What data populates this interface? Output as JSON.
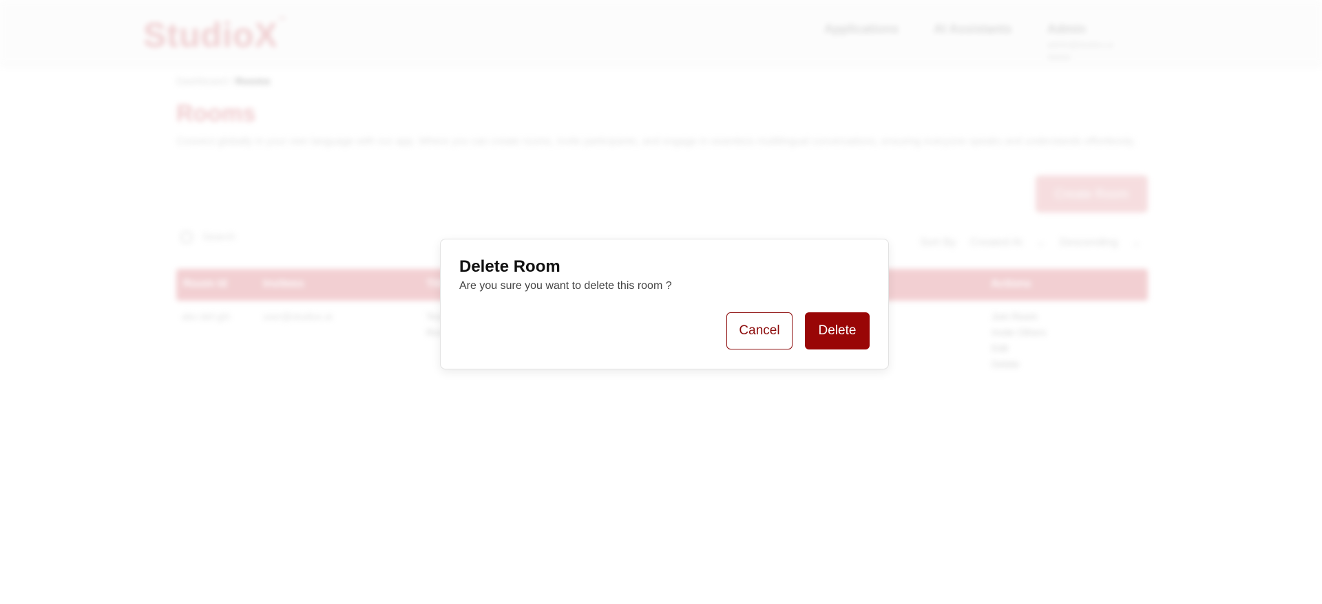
{
  "header": {
    "logo": "StudioX",
    "logo_trademark": "™",
    "nav": {
      "applications": "Applications",
      "ai_assistants": "AI Assistants",
      "admin": "Admin",
      "admin_email": "admin@studiox.ai",
      "admin_role": "Admin"
    }
  },
  "breadcrumb": {
    "parent": "Dashboard",
    "separator": "/",
    "current": "Rooms"
  },
  "page": {
    "title": "Rooms",
    "description": "Connect globally in your own language with our app. Where you can create rooms, invite participants, and engage in seamless multilingual conversations, ensuring everyone speaks and understands effortlessly.",
    "create_button": "Create Room"
  },
  "toolbar": {
    "search_placeholder": "Search",
    "sort_label": "Sort By",
    "sort_field": "Created At",
    "sort_order": "Descending"
  },
  "table": {
    "columns": [
      "Room Id",
      "Invitees",
      "Title",
      "Actions"
    ],
    "rows": [
      {
        "room_id": "abc-def-ghi",
        "invitee": "user@studiox.ai",
        "title_line1": "Test",
        "title_line2": "Room",
        "actions": [
          "Join Room",
          "Invite Others",
          "Edit",
          "Delete"
        ]
      }
    ]
  },
  "modal": {
    "title": "Delete Room",
    "message": "Are you sure you want to delete this room ?",
    "cancel_label": "Cancel",
    "delete_label": "Delete"
  },
  "colors": {
    "accent": "#990606",
    "accent_light": "#e8a9ae"
  }
}
